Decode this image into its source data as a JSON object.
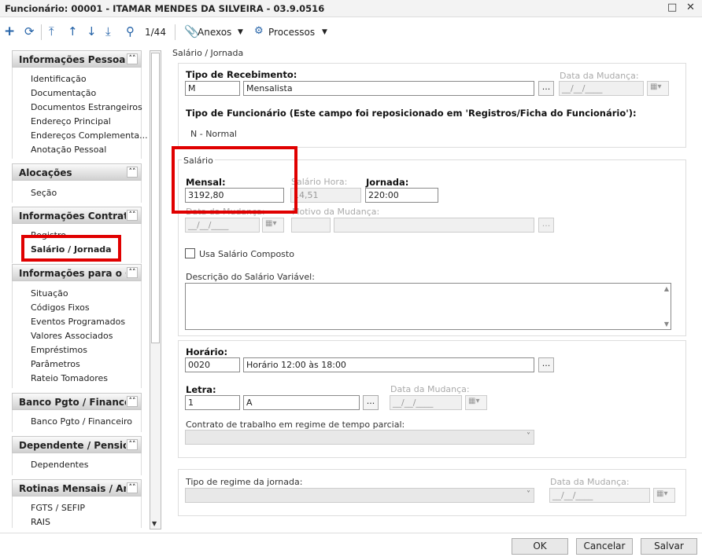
{
  "window": {
    "title": "Funcionário: 00001 - ITAMAR MENDES DA SILVEIRA - 03.9.0516"
  },
  "toolbar": {
    "page_counter": "1/44",
    "anexos": "Anexos",
    "processos": "Processos"
  },
  "sidebar": {
    "groups": [
      {
        "title": "Informações Pessoais",
        "items": [
          "Identificação",
          "Documentação",
          "Documentos Estrangeiros",
          "Endereço Principal",
          "Endereços Complementa...",
          "Anotação Pessoal"
        ]
      },
      {
        "title": "Alocações",
        "items": [
          "Seção"
        ]
      },
      {
        "title": "Informações Contratuai",
        "items": [
          "Registro",
          "Salário / Jornada"
        ]
      },
      {
        "title": "Informações para o Cál",
        "items": [
          "Situação",
          "Códigos Fixos",
          "Eventos Programados",
          "Valores Associados",
          "Empréstimos",
          "Parâmetros",
          "Rateio Tomadores"
        ]
      },
      {
        "title": "Banco Pgto / Financeir",
        "items": [
          "Banco Pgto / Financeiro"
        ]
      },
      {
        "title": "Dependente / Pensioni",
        "items": [
          "Dependentes"
        ]
      },
      {
        "title": "Rotinas Mensais / Anu",
        "items": [
          "FGTS / SEFIP",
          "RAIS"
        ]
      }
    ]
  },
  "content": {
    "section_title": "Salário / Jornada",
    "tipo_recebimento": {
      "label": "Tipo de Recebimento:",
      "code": "M",
      "desc": "Mensalista",
      "ellipsis": "...",
      "data_mudanca_label": "Data da Mudança:",
      "data_mudanca_value": "__/__/____"
    },
    "tipo_funcionario": {
      "label": "Tipo de Funcionário (Este campo foi reposicionado em 'Registros/Ficha do Funcionário'):",
      "value": "N - Normal"
    },
    "salario": {
      "legend": "Salário",
      "mensal_label": "Mensal:",
      "mensal_value": "3192,80",
      "hora_label": "Salário Hora:",
      "hora_value": "14,51",
      "jornada_label": "Jornada:",
      "jornada_value": "220:00",
      "data_mudanca_label": "Data da Mudança:",
      "data_mudanca_value": "__/__/____",
      "motivo_label": "Motivo da Mudança:",
      "ellipsis": "...",
      "composto_label": "Usa Salário Composto",
      "descricao_label": "Descrição do Salário Variável:"
    },
    "horario": {
      "label": "Horário:",
      "code": "0020",
      "desc": "Horário 12:00 às 18:00",
      "ellipsis": "..."
    },
    "letra": {
      "label": "Letra:",
      "code": "1",
      "desc": "A",
      "ellipsis": "...",
      "data_mudanca_label": "Data da Mudança:",
      "data_mudanca_value": "__/__/____"
    },
    "contrato": {
      "label": "Contrato de trabalho em regime de tempo parcial:"
    },
    "regime": {
      "label": "Tipo de regime da jornada:",
      "data_mudanca_label": "Data da Mudança:",
      "data_mudanca_value": "__/__/____"
    }
  },
  "footer": {
    "ok": "OK",
    "cancel": "Cancelar",
    "save": "Salvar"
  }
}
